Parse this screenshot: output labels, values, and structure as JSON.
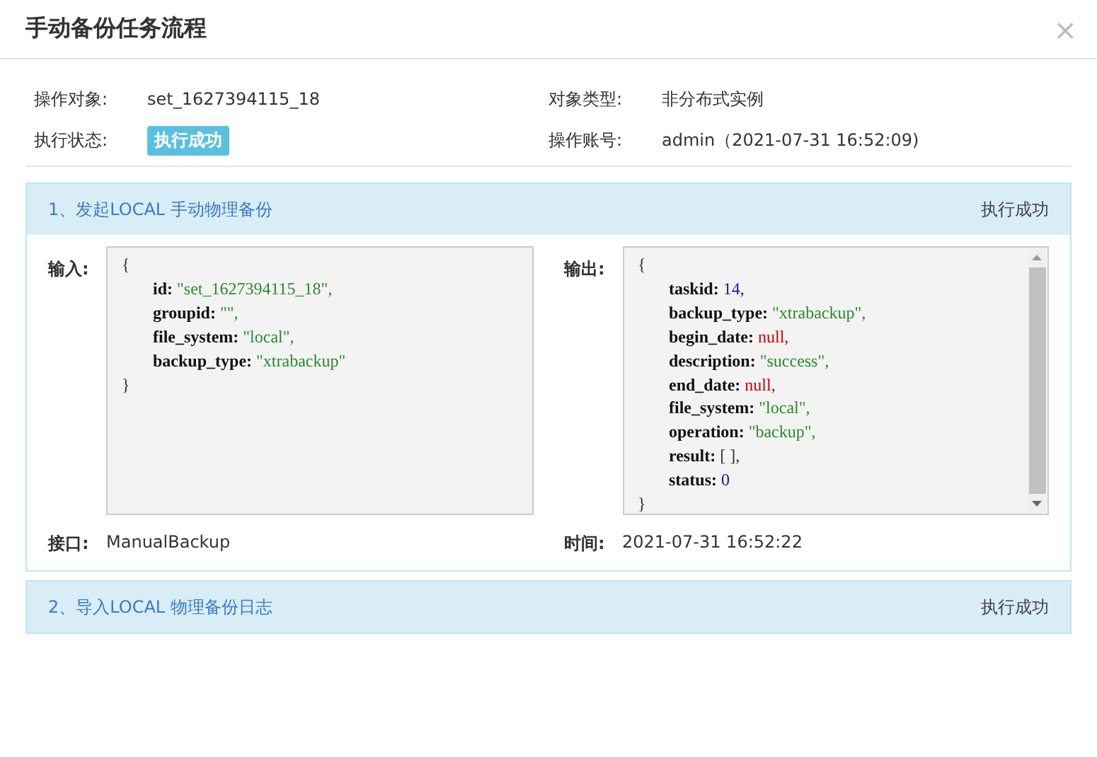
{
  "dialog": {
    "title": "手动备份任务流程",
    "close": "×"
  },
  "info": [
    {
      "label": "操作对象:",
      "value": "set_1627394115_18",
      "kind": "text"
    },
    {
      "label": "对象类型:",
      "value": "非分布式实例",
      "kind": "text"
    },
    {
      "label": "执行状态:",
      "value": "执行成功",
      "kind": "badge"
    },
    {
      "label": "操作账号:",
      "value": "admin（2021-07-31 16:52:09)",
      "kind": "text"
    }
  ],
  "steps": [
    {
      "title": "1、发起LOCAL 手动物理备份",
      "status": "执行成功",
      "expanded": true,
      "input": {
        "label": "输入:",
        "open": "{",
        "close": "}",
        "lines": [
          {
            "key": "id:",
            "value": "\"set_1627394115_18\",",
            "color": "#2a8a2a"
          },
          {
            "key": "groupid:",
            "value": "\"\",",
            "color": "#2a8a2a"
          },
          {
            "key": "file_system:",
            "value": "\"local\",",
            "color": "#2a8a2a"
          },
          {
            "key": "backup_type:",
            "value": "\"xtrabackup\"",
            "color": "#2a8a2a"
          }
        ]
      },
      "output": {
        "label": "输出:",
        "open": "{",
        "close": "}",
        "lines": [
          {
            "key": "taskid:",
            "value": "14,",
            "color": "#1a1aa6"
          },
          {
            "key": "backup_type:",
            "value": "\"xtrabackup\",",
            "color": "#2a8a2a"
          },
          {
            "key": "begin_date:",
            "value": "null,",
            "color": "#cc0000"
          },
          {
            "key": "description:",
            "value": "\"success\",",
            "color": "#2a8a2a"
          },
          {
            "key": "end_date:",
            "value": "null,",
            "color": "#cc0000"
          },
          {
            "key": "file_system:",
            "value": "\"local\",",
            "color": "#2a8a2a"
          },
          {
            "key": "operation:",
            "value": "\"backup\",",
            "color": "#2a8a2a"
          },
          {
            "key": "result:",
            "value": "[ ],",
            "color": "#333333"
          },
          {
            "key": "status:",
            "value": "0",
            "color": "#1a1aa6"
          }
        ]
      },
      "api_label": "接口:",
      "api": "ManualBackup",
      "time_label": "时间:",
      "time": "2021-07-31 16:52:22"
    },
    {
      "title": "2、导入LOCAL 物理备份日志",
      "status": "执行成功",
      "expanded": false
    }
  ]
}
